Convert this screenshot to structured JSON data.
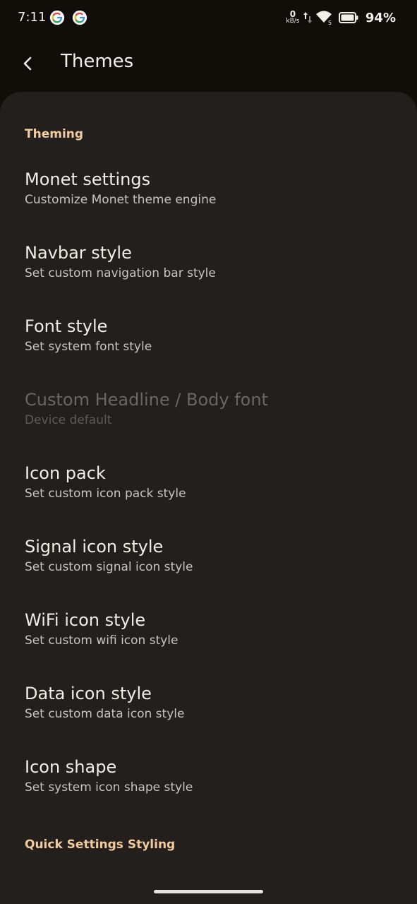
{
  "status_bar": {
    "time": "7:11",
    "net_speed_value": "0",
    "net_speed_unit": "kB/s",
    "battery_percent": "94%"
  },
  "app_bar": {
    "title": "Themes"
  },
  "sections": [
    {
      "title": "Theming",
      "items": [
        {
          "title": "Monet settings",
          "summary": "Customize Monet theme engine",
          "enabled": true
        },
        {
          "title": "Navbar style",
          "summary": "Set custom navigation bar style",
          "enabled": true
        },
        {
          "title": "Font style",
          "summary": "Set system font style",
          "enabled": true
        },
        {
          "title": "Custom Headline / Body font",
          "summary": "Device default",
          "enabled": false
        },
        {
          "title": "Icon pack",
          "summary": "Set custom icon pack style",
          "enabled": true
        },
        {
          "title": "Signal icon style",
          "summary": "Set custom signal icon style",
          "enabled": true
        },
        {
          "title": "WiFi icon style",
          "summary": "Set custom wifi icon style",
          "enabled": true
        },
        {
          "title": "Data icon style",
          "summary": "Set custom data icon style",
          "enabled": true
        },
        {
          "title": "Icon shape",
          "summary": "Set system icon shape style",
          "enabled": true
        }
      ]
    },
    {
      "title": "Quick Settings Styling",
      "items": []
    }
  ],
  "colors": {
    "background": "#110e0a",
    "sheet": "#221f1c",
    "accent": "#f2cc9e",
    "primary_text": "#f1ece6",
    "secondary_text": "#c9c4be"
  },
  "icons": [
    "google-icon",
    "data-arrows-icon",
    "wifi-icon",
    "battery-icon",
    "back-arrow-icon"
  ]
}
